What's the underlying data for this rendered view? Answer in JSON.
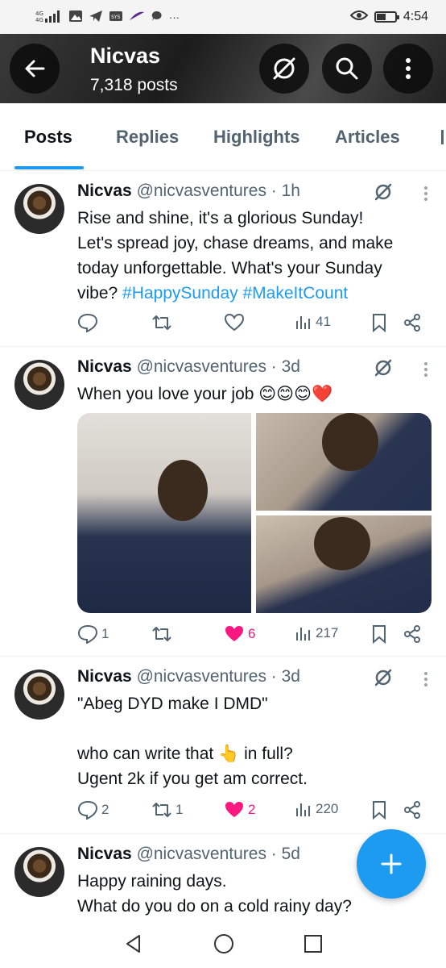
{
  "status_bar": {
    "time": "4:54",
    "left_glyphs": "▲ ➤",
    "battery_level": 0.45,
    "dots": "···"
  },
  "header": {
    "title": "Nicvas",
    "post_count": "7,318 posts"
  },
  "tabs": [
    {
      "label": "Posts",
      "active": true
    },
    {
      "label": "Replies",
      "active": false
    },
    {
      "label": "Highlights",
      "active": false
    },
    {
      "label": "Articles",
      "active": false
    }
  ],
  "posts": [
    {
      "name": "Nicvas",
      "handle": "@nicvasventures · 1h",
      "text_line1": "Rise and shine, it's a glorious Sunday!",
      "text_line2": "Let's spread joy, chase dreams, and make",
      "text_line3": "today unforgettable. What's your Sunday",
      "text_line4_prefix": "vibe?",
      "hashtag1": "#HappySunday",
      "hashtag2": "#MakeItCount",
      "replies": "",
      "reposts": "",
      "likes": "",
      "views": "41"
    },
    {
      "name": "Nicvas",
      "handle": "@nicvasventures · 3d",
      "text": "When you love your job 😊😊😊❤️",
      "replies": "1",
      "reposts": "",
      "likes": "6",
      "views": "217"
    },
    {
      "name": "Nicvas",
      "handle": "@nicvasventures · 3d",
      "text_line1": "\"Abeg DYD make I DMD\"",
      "text_line2": "who can write that 👆 in full?",
      "text_line3": "Ugent 2k if you get am correct.",
      "replies": "2",
      "reposts": "1",
      "likes": "2",
      "views": "220"
    },
    {
      "name": "Nicvas",
      "handle": "@nicvasventures · 5d",
      "text_line1": "Happy raining days.",
      "text_line2": "What do you do on a cold rainy day?"
    }
  ],
  "colors": {
    "accent": "#1d9bf0",
    "like": "#f91880",
    "muted": "#536471"
  }
}
